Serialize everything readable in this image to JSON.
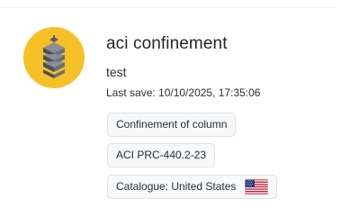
{
  "project": {
    "title": "aci confinement",
    "description": "test",
    "last_save": "Last save: 10/10/2025, 17:35:06",
    "avatar_icon": "layered-column-icon",
    "avatar_color": "#f6c028",
    "tags": [
      {
        "label": "Confinement of column"
      },
      {
        "label": "ACI PRC-440.2-23"
      },
      {
        "label": "Catalogue: United States",
        "icon": "us-flag-icon"
      }
    ]
  }
}
